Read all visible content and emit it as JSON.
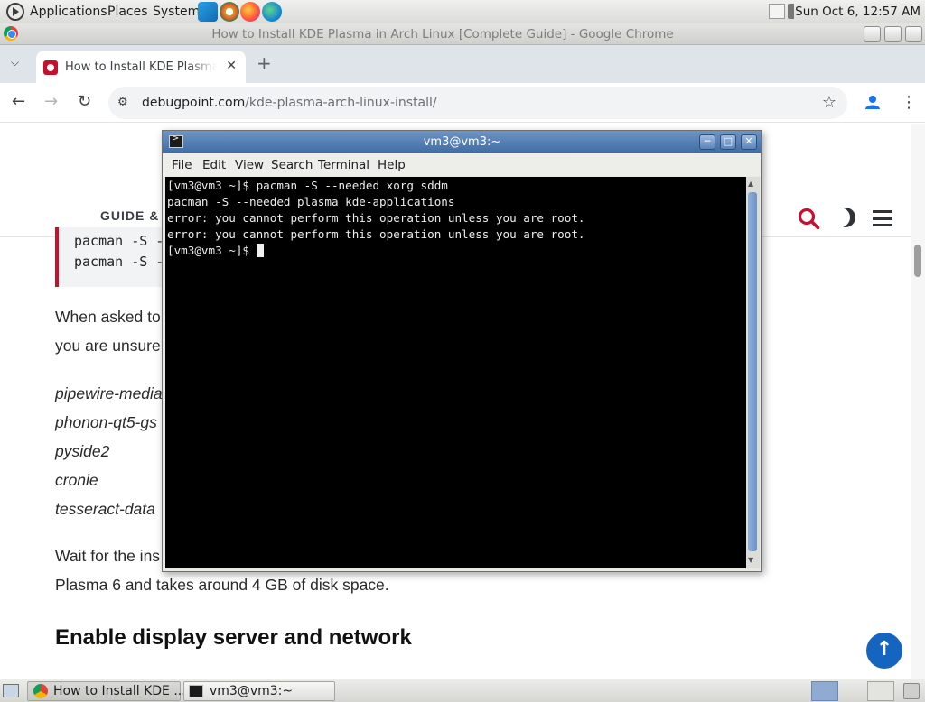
{
  "top_panel": {
    "menus": [
      "Applications",
      "Places",
      "System"
    ],
    "clock": "Sun Oct  6, 12:57 AM",
    "launchers": [
      "vscode-icon",
      "chrome-dev-icon",
      "firefox-icon",
      "edge-dev-icon"
    ]
  },
  "chrome": {
    "window_title": "How to Install KDE Plasma in Arch Linux [Complete Guide] - Google Chrome",
    "tab_label": "How to Install KDE Plasma in Arch Linux [Complete Guide]",
    "url_host": "debugpoint.com",
    "url_path": "/kde-plasma-arch-linux-install/"
  },
  "page": {
    "nav_label": "GUIDE &",
    "code_lines": [
      "pacman -S -",
      "pacman -S -"
    ],
    "paragraph1": [
      "When asked to",
      "you are unsure,"
    ],
    "packages": [
      "pipewire-media",
      "phonon-qt5-gs",
      "pyside2",
      "cronie",
      "tesseract-data"
    ],
    "paragraph2": [
      "Wait for the ins",
      "Plasma 6 and takes around 4 GB of disk space."
    ],
    "section_heading": "Enable display server and network",
    "back_to_top": "↑"
  },
  "terminal": {
    "title": "vm3@vm3:~",
    "menu": [
      "File",
      "Edit",
      "View",
      "Search",
      "Terminal",
      "Help"
    ],
    "lines": [
      "[vm3@vm3 ~]$ pacman -S --needed xorg sddm",
      "pacman -S --needed plasma kde-applications",
      "error: you cannot perform this operation unless you are root.",
      "error: you cannot perform this operation unless you are root.",
      "[vm3@vm3 ~]$ "
    ]
  },
  "taskbar": {
    "tasks": [
      "How to Install KDE ...",
      "vm3@vm3:~"
    ]
  },
  "colors": {
    "accent_red": "#c8102e",
    "terminal_bg": "#000000",
    "titlebar_blue": "#3f6ca5",
    "back_to_top_blue": "#1565c0"
  }
}
